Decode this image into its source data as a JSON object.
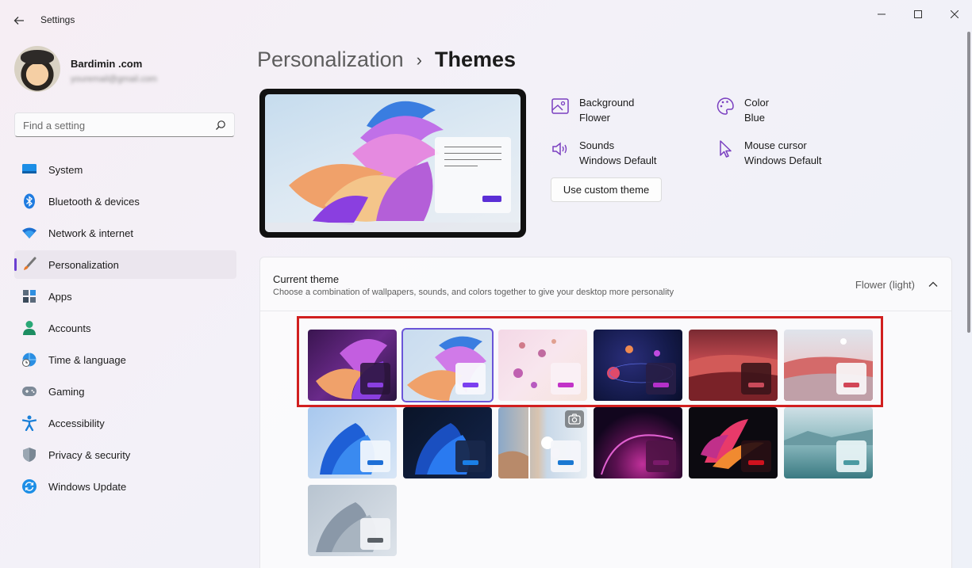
{
  "window": {
    "title": "Settings"
  },
  "profile": {
    "name": "Bardimin .com",
    "email": "youremail@gmail.com"
  },
  "search": {
    "placeholder": "Find a setting"
  },
  "nav": {
    "items": [
      {
        "label": "System",
        "icon": "monitor-icon"
      },
      {
        "label": "Bluetooth & devices",
        "icon": "bluetooth-icon"
      },
      {
        "label": "Network & internet",
        "icon": "wifi-icon"
      },
      {
        "label": "Personalization",
        "icon": "brush-icon",
        "active": true
      },
      {
        "label": "Apps",
        "icon": "apps-icon"
      },
      {
        "label": "Accounts",
        "icon": "person-icon"
      },
      {
        "label": "Time & language",
        "icon": "globe-clock-icon"
      },
      {
        "label": "Gaming",
        "icon": "gamepad-icon"
      },
      {
        "label": "Accessibility",
        "icon": "accessibility-icon"
      },
      {
        "label": "Privacy & security",
        "icon": "shield-icon"
      },
      {
        "label": "Windows Update",
        "icon": "update-icon"
      }
    ]
  },
  "breadcrumb": {
    "parent": "Personalization",
    "separator": "›",
    "current": "Themes"
  },
  "properties": {
    "background": {
      "label": "Background",
      "value": "Flower"
    },
    "color": {
      "label": "Color",
      "value": "Blue"
    },
    "sounds": {
      "label": "Sounds",
      "value": "Windows Default"
    },
    "cursor": {
      "label": "Mouse cursor",
      "value": "Windows Default"
    }
  },
  "custom_theme_button": "Use custom theme",
  "current_theme": {
    "title": "Current theme",
    "description": "Choose a combination of wallpapers, sounds, and colors together to give your desktop more personality",
    "value": "Flower (light)"
  },
  "themes": [
    {
      "name": "flower-dark",
      "accent": "#8a3fe0",
      "selected": false
    },
    {
      "name": "flower-light",
      "accent": "#7b3ff0",
      "selected": true
    },
    {
      "name": "glow-pink",
      "accent": "#c232c8",
      "selected": false
    },
    {
      "name": "planets",
      "accent": "#b430c9",
      "selected": false
    },
    {
      "name": "dunes-dark",
      "accent": "#c94a5a",
      "selected": false
    },
    {
      "name": "dunes-light",
      "accent": "#d24657",
      "selected": false
    },
    {
      "name": "bloom-light",
      "accent": "#1e6fd6",
      "selected": false
    },
    {
      "name": "bloom-dark",
      "accent": "#1a7fe6",
      "selected": false
    },
    {
      "name": "spotlight",
      "accent": "#1a78d2",
      "selected": false
    },
    {
      "name": "captured-motion",
      "accent": "#7a1a6a",
      "selected": false
    },
    {
      "name": "flow",
      "accent": "#d0121e",
      "selected": false
    },
    {
      "name": "lake",
      "accent": "#4a9aa2",
      "selected": false
    },
    {
      "name": "sunrise",
      "accent": "#5a6066",
      "selected": false
    }
  ],
  "colors": {
    "accent": "#6b3fd1",
    "highlight_border": "#d11f1f"
  }
}
